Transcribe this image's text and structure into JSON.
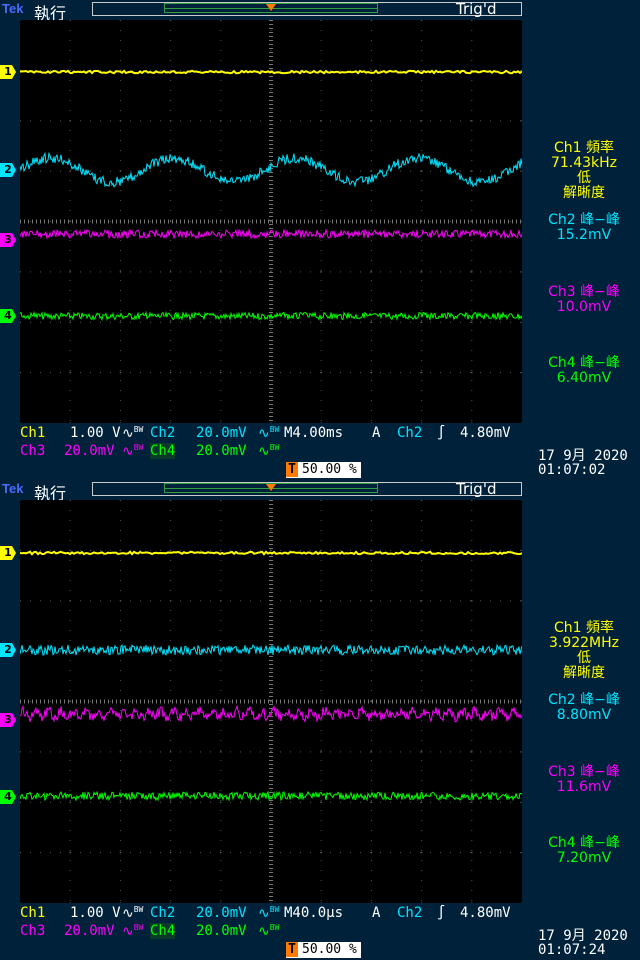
{
  "colors": {
    "ch1": "#ffff00",
    "ch2": "#00e5ff",
    "ch3": "#ff00ff",
    "ch4": "#00ff00",
    "trigger": "#ff7b00",
    "brand": "#4a6cff"
  },
  "screens": [
    {
      "brand": "Tek",
      "run_state": "執行",
      "trig_state": "Trig'd",
      "markers": {
        "trigger": "T",
        "ch1": "1",
        "ch2": "2",
        "ch3": "3",
        "ch4": "4"
      },
      "measurements": [
        {
          "title": "Ch1 頻率",
          "value": "71.43kHz",
          "note": "低",
          "note2": "解晰度"
        },
        {
          "title": "Ch2 峰−峰",
          "value": "15.2mV"
        },
        {
          "title": "Ch3 峰−峰",
          "value": "10.0mV"
        },
        {
          "title": "Ch4 峰−峰",
          "value": "6.40mV"
        }
      ],
      "status": {
        "ch1_label": "Ch1",
        "ch1_scale": "1.00 V",
        "ch2_label": "Ch2",
        "ch2_scale": "20.0mV",
        "timebase": "M4.00ms",
        "trig_mode": "A",
        "trig_src": "Ch2",
        "trig_level": "4.80mV",
        "ch3_label": "Ch3",
        "ch3_scale": "20.0mV",
        "ch4_label": "Ch4",
        "ch4_scale": "20.0mV",
        "trig_pos": "50.00 %",
        "date": "17 9月  2020",
        "time": "01:07:02"
      }
    },
    {
      "brand": "Tek",
      "run_state": "執行",
      "trig_state": "Trig'd",
      "markers": {
        "trigger": "T",
        "ch1": "1",
        "ch2": "2",
        "ch3": "3",
        "ch4": "4"
      },
      "measurements": [
        {
          "title": "Ch1 頻率",
          "value": "3.922MHz",
          "note": "低",
          "note2": "解晰度"
        },
        {
          "title": "Ch2 峰−峰",
          "value": "8.80mV"
        },
        {
          "title": "Ch3 峰−峰",
          "value": "11.6mV"
        },
        {
          "title": "Ch4 峰−峰",
          "value": "7.20mV"
        }
      ],
      "status": {
        "ch1_label": "Ch1",
        "ch1_scale": "1.00 V",
        "ch2_label": "Ch2",
        "ch2_scale": "20.0mV",
        "timebase": "M40.0µs",
        "trig_mode": "A",
        "trig_src": "Ch2",
        "trig_level": "4.80mV",
        "ch3_label": "Ch3",
        "ch3_scale": "20.0mV",
        "ch4_label": "Ch4",
        "ch4_scale": "20.0mV",
        "trig_pos": "50.00 %",
        "date": "17 9月  2020",
        "time": "01:07:24"
      }
    }
  ]
}
